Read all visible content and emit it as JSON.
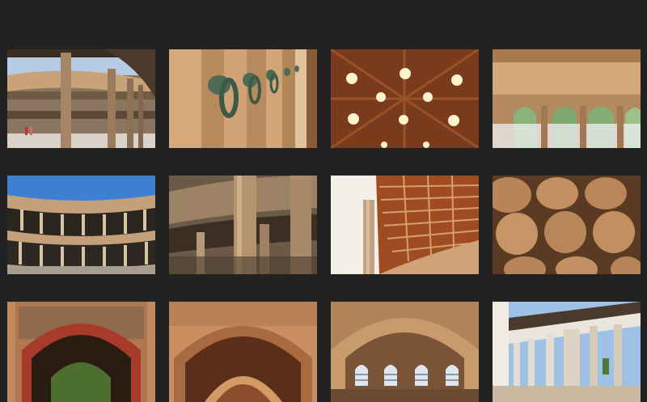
{
  "gallery": {
    "background": "#222222",
    "rows": 3,
    "columns": 4
  },
  "thumbnails": [
    {
      "name": "palace-courtyard-colonnade-thumbnail"
    },
    {
      "name": "bronze-ring-knockers-thumbnail"
    },
    {
      "name": "star-cutout-ceiling-thumbnail"
    },
    {
      "name": "arched-window-gallery-thumbnail"
    },
    {
      "name": "circular-courtyard-thumbnail"
    },
    {
      "name": "stone-columns-thumbnail"
    },
    {
      "name": "coffered-wooden-ceiling-thumbnail"
    },
    {
      "name": "carved-stone-texture-thumbnail"
    },
    {
      "name": "moorish-red-arch-thumbnail"
    },
    {
      "name": "carved-arch-passage-thumbnail"
    },
    {
      "name": "lattice-window-arch-thumbnail"
    },
    {
      "name": "white-arcade-columns-thumbnail"
    }
  ]
}
